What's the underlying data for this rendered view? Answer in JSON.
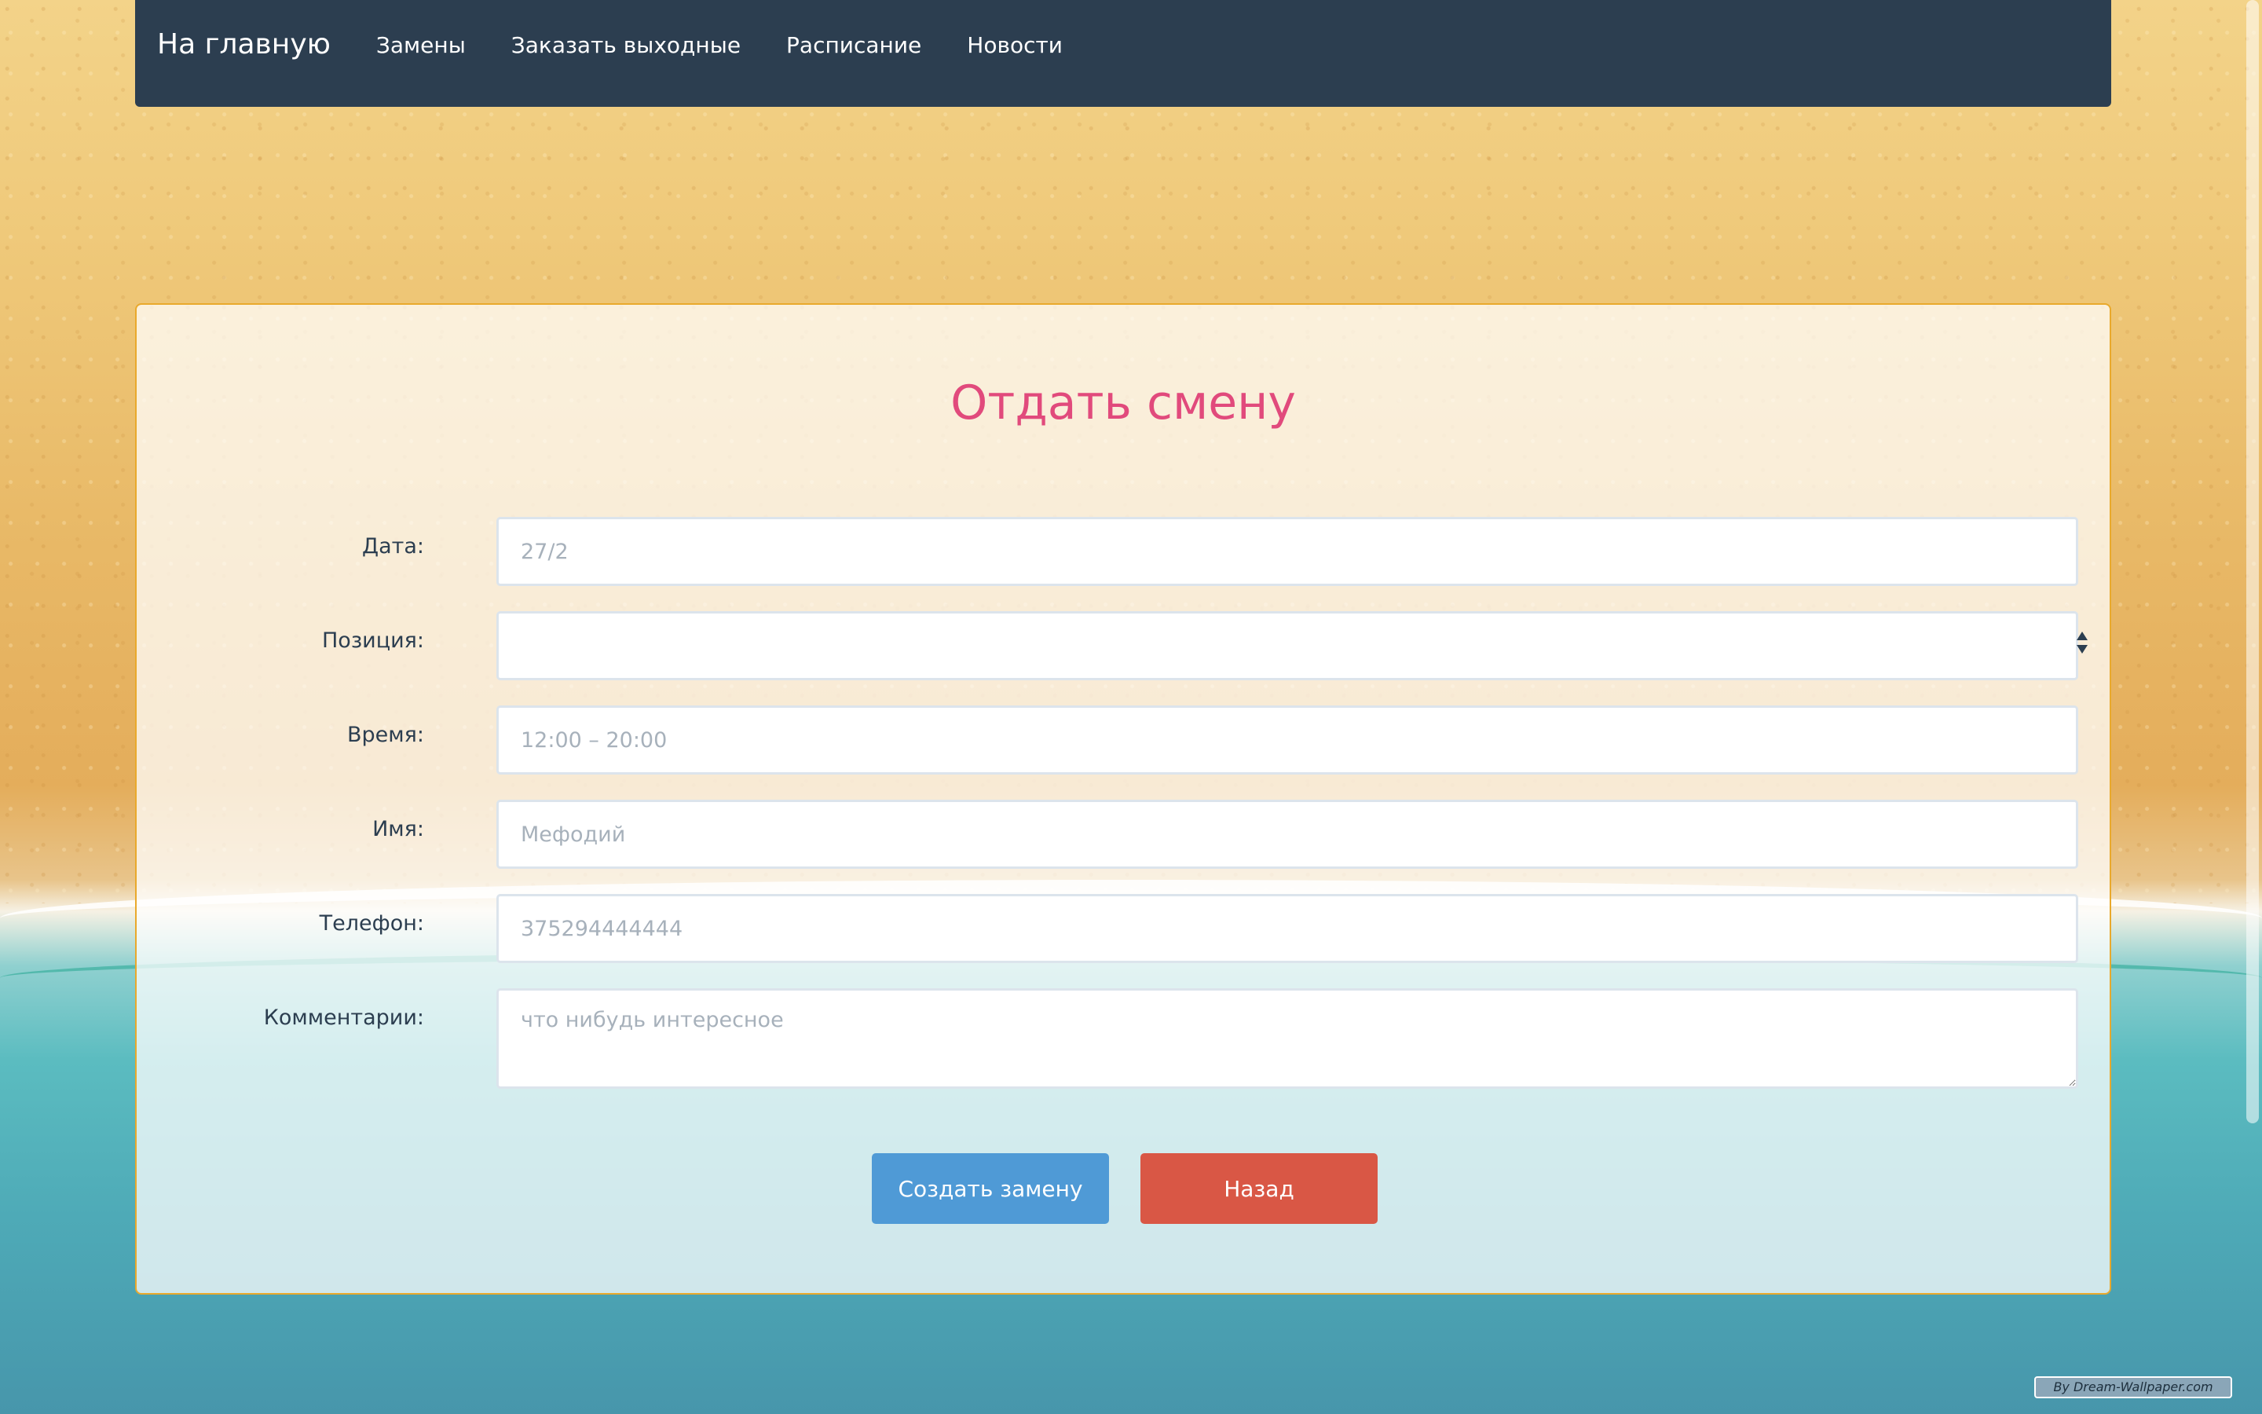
{
  "navbar": {
    "brand": "На главную",
    "links": [
      "Замены",
      "Заказать выходные",
      "Расписание",
      "Новости"
    ]
  },
  "form": {
    "title": "Отдать смену",
    "fields": {
      "date": {
        "label": "Дата:",
        "placeholder": "27/2"
      },
      "position": {
        "label": "Позиция:",
        "value": ""
      },
      "time": {
        "label": "Время:",
        "placeholder": "12:00 – 20:00"
      },
      "name": {
        "label": "Имя:",
        "placeholder": "Мефодий"
      },
      "phone": {
        "label": "Телефон:",
        "placeholder": "375294444444"
      },
      "comment": {
        "label": "Комментарии:",
        "placeholder": "что нибудь интересное"
      }
    },
    "submit_label": "Создать замену",
    "back_label": "Назад"
  },
  "watermark": "By Dream-Wallpaper.com",
  "colors": {
    "navbar": "#2c3e50",
    "title": "#e14a7c",
    "card_border": "#e9a92c",
    "primary_button": "#4f9ad6",
    "danger_button": "#d95745"
  }
}
